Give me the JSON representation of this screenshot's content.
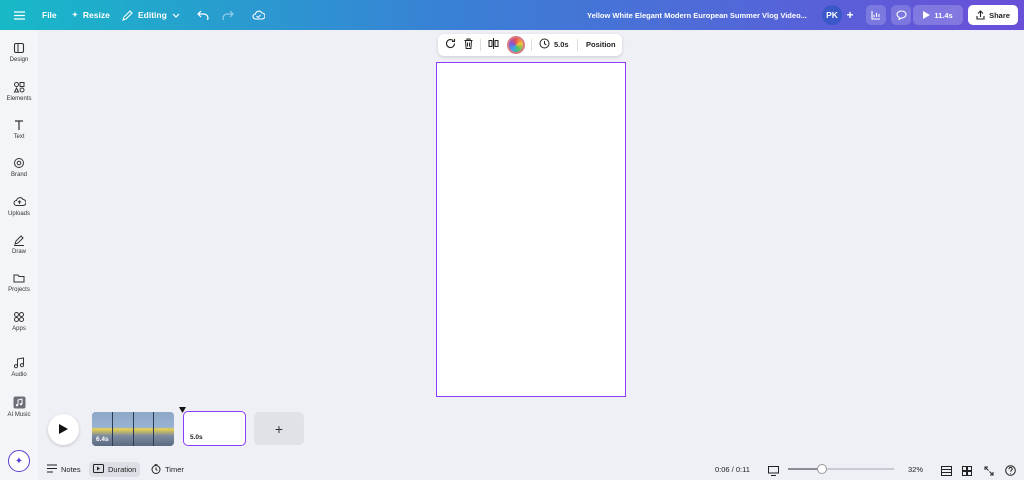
{
  "topbar": {
    "file_label": "File",
    "resize_label": "Resize",
    "editing_label": "Editing",
    "design_title": "Yellow White Elegant Modern European Summer Vlog Video...",
    "avatar_initials": "PK",
    "play_label": "11.4s",
    "share_label": "Share"
  },
  "sidebar": {
    "items": [
      {
        "label": "Design",
        "icon": "design-icon"
      },
      {
        "label": "Elements",
        "icon": "elements-icon"
      },
      {
        "label": "Text",
        "icon": "text-icon"
      },
      {
        "label": "Brand",
        "icon": "brand-icon"
      },
      {
        "label": "Uploads",
        "icon": "uploads-icon"
      },
      {
        "label": "Draw",
        "icon": "draw-icon"
      },
      {
        "label": "Projects",
        "icon": "folder-icon"
      },
      {
        "label": "Apps",
        "icon": "apps-icon"
      },
      {
        "label": "Audio",
        "icon": "music-note-icon"
      },
      {
        "label": "AI Music",
        "icon": "ai-music-icon"
      }
    ]
  },
  "floating_toolbar": {
    "duration_label": "5.0s",
    "position_label": "Position"
  },
  "timeline": {
    "clips": [
      {
        "duration": "6.4s"
      },
      {
        "duration": "5.0s"
      }
    ],
    "add_label": "+"
  },
  "bottombar": {
    "notes_label": "Notes",
    "duration_label": "Duration",
    "timer_label": "Timer",
    "time_readout": "0:06 / 0:11",
    "zoom_label": "32%",
    "zoom_level": 0.32
  },
  "colors": {
    "accent": "#8b3dff",
    "topbar_start": "#17b9c8",
    "topbar_end": "#6a4fd9"
  }
}
